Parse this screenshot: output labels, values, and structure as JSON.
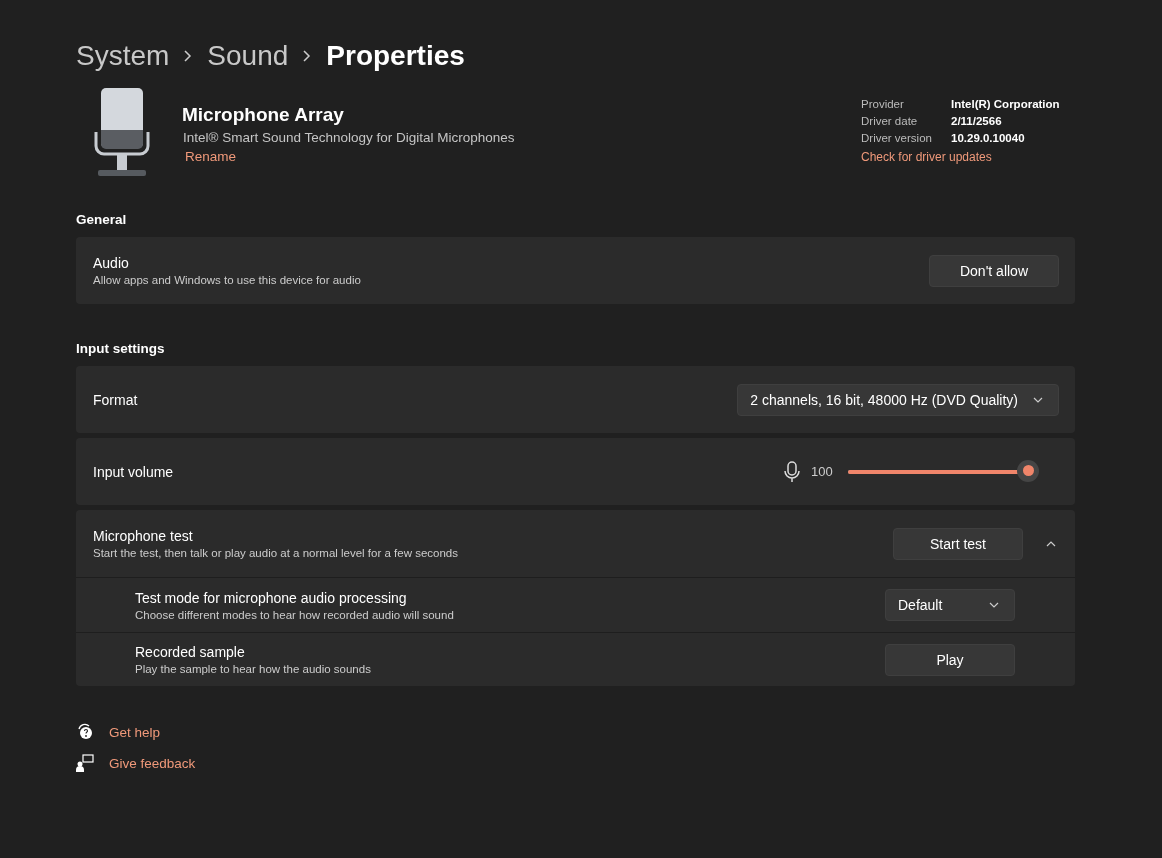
{
  "breadcrumb": [
    "System",
    "Sound",
    "Properties"
  ],
  "device": {
    "name": "Microphone Array",
    "description": "Intel® Smart Sound Technology for Digital Microphones",
    "rename": "Rename"
  },
  "driver_info": [
    {
      "label": "Provider",
      "value": "Intel(R) Corporation"
    },
    {
      "label": "Driver date",
      "value": "2/11/2566"
    },
    {
      "label": "Driver version",
      "value": "10.29.0.10040"
    }
  ],
  "driver_link": "Check for driver updates",
  "sections": [
    {
      "title": "General",
      "cards": [
        {
          "kind": "button",
          "title": "Audio",
          "subtitle": "Allow apps and Windows to use this device for audio",
          "button": "Don't allow"
        }
      ]
    },
    {
      "title": "Input settings",
      "cards": [
        {
          "kind": "dropdown",
          "title": "Format",
          "value": "2 channels, 16 bit, 48000 Hz (DVD Quality)"
        },
        {
          "kind": "slider",
          "title": "Input volume",
          "reading": "100",
          "level": 1.0
        },
        {
          "kind": "expander",
          "title": "Microphone test",
          "subtitle": "Start the test, then talk or play audio at a normal level for a few seconds",
          "button": "Start test",
          "expanded": true,
          "children": [
            {
              "kind": "dropdown",
              "title": "Test mode for microphone audio processing",
              "subtitle": "Choose different modes to hear how recorded audio will sound",
              "value": "Default"
            },
            {
              "kind": "button",
              "title": "Recorded sample",
              "subtitle": "Play the sample to hear how the audio sounds",
              "button": "Play"
            }
          ]
        }
      ]
    }
  ],
  "footer_links": [
    {
      "kind": "help",
      "label": "Get help"
    },
    {
      "kind": "feedback",
      "label": "Give feedback"
    }
  ]
}
